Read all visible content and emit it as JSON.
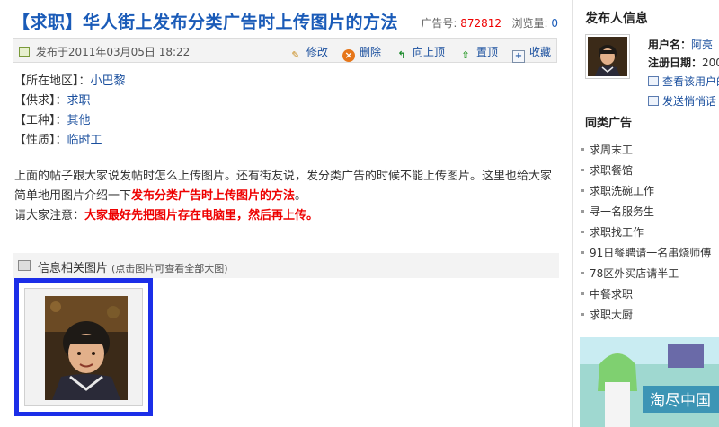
{
  "colors": {
    "title": "#1a5bb8",
    "highlight": "#ee0000",
    "link": "#1a4f9e",
    "frame": "#1b2ee8"
  },
  "header": {
    "title": "【求职】华人街上发布分类广告时上传图片的方法",
    "ad_no_label": "广告号:",
    "ad_no": "872812",
    "views_label": "浏览量:",
    "views": "0"
  },
  "toolbar": {
    "published": "发布于2011年03月05日 18:22",
    "actions": [
      {
        "label": "修改",
        "icon": "edit-icon"
      },
      {
        "label": "删除",
        "icon": "delete-icon"
      },
      {
        "label": "向上顶",
        "icon": "bump-up-icon"
      },
      {
        "label": "置顶",
        "icon": "pin-top-icon"
      },
      {
        "label": "收藏",
        "icon": "favorite-icon"
      }
    ]
  },
  "fields": [
    {
      "label": "【所在地区】：",
      "value": "小巴黎"
    },
    {
      "label": "【供求】：",
      "value": "求职"
    },
    {
      "label": "【工种】：",
      "value": "其他"
    },
    {
      "label": "【性质】：",
      "value": "临时工"
    }
  ],
  "body": {
    "p1_a": "上面的帖子跟大家说发帖时怎么上传图片。还有街友说，发分类广告的时候不能上传图片。这里也给大家",
    "p1_b": "简单地用图片介绍一下",
    "p1_hl": "发布分类广告时上传图片的方法",
    "p1_end": "。",
    "p2_label": "请大家注意：",
    "p2_hl": "大家最好先把图片存在电脑里，然后再上传。"
  },
  "images": {
    "title": "信息相关图片",
    "hint": "(点击图片可查看全部大图)"
  },
  "sidebar": {
    "poster_title": "发布人信息",
    "username_label": "用户名：",
    "username": "阿亮",
    "register_label": "注册日期：",
    "register_value": "200",
    "view_user_link": "查看该用户的",
    "message_link": "发送悄悄话",
    "similar_title": "同类广告",
    "similar_items": [
      "求周末工",
      "求职餐馆",
      "求职洗碗工作",
      "寻一名服务生",
      "求职找工作",
      "91日餐聘请一名串烧师傅",
      "78区外买店请半工",
      "中餐求职",
      "求职大厨"
    ],
    "banner_text": "淘尽中国"
  }
}
